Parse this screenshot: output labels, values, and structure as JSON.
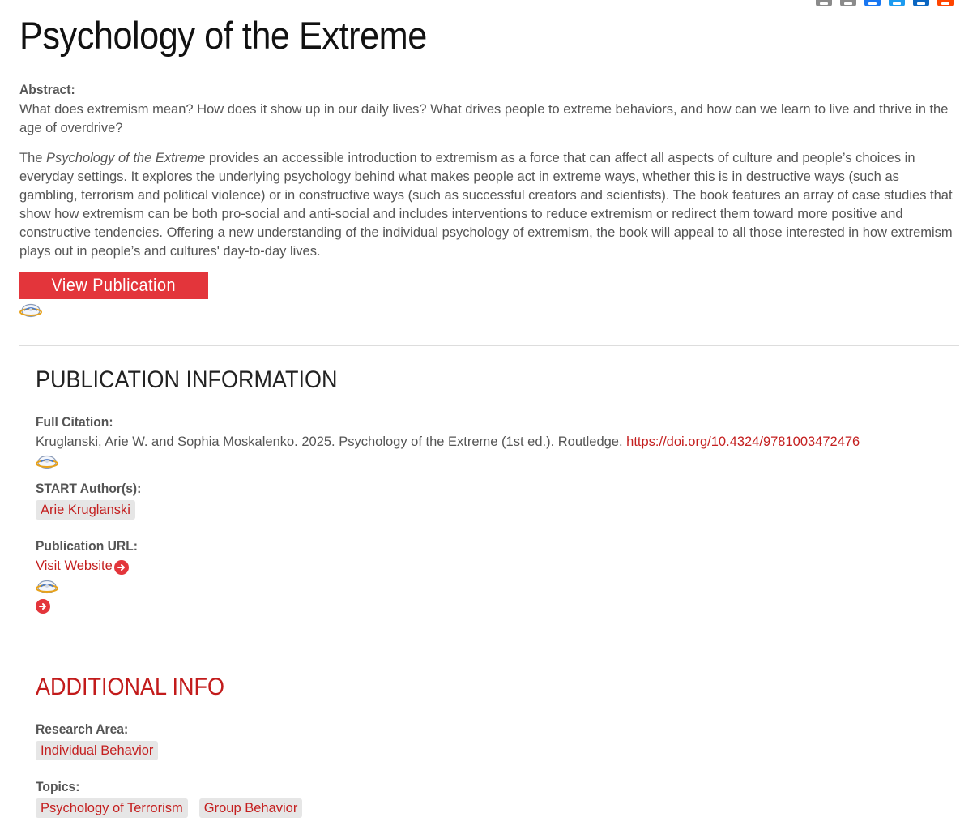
{
  "share": {
    "buttons": [
      {
        "name": "print",
        "color": "#8b8b8b"
      },
      {
        "name": "email",
        "color": "#8b8b8b"
      },
      {
        "name": "facebook",
        "color": "#1877f2"
      },
      {
        "name": "twitter",
        "color": "#1d9bf0"
      },
      {
        "name": "linkedin",
        "color": "#0a66c2"
      },
      {
        "name": "reddit",
        "color": "#ff4500"
      }
    ]
  },
  "page": {
    "title": "Psychology of the Extreme"
  },
  "abstract": {
    "label": "Abstract:",
    "para1": "What does extremism mean? How does it show up in our daily lives? What drives people to extreme behaviors, and how can we learn to live and thrive in the age of overdrive?",
    "para2_prefix": "The ",
    "para2_italic": "Psychology of the Extreme",
    "para2_rest": " provides an accessible introduction to extremism as a force that can affect all aspects of culture and people’s choices in everyday settings. It explores the underlying psychology behind what makes people act in extreme ways, whether this is in destructive ways (such as gambling, terrorism and political violence) or in constructive ways (such as successful creators and scientists). The book features an array of case studies that show how extremism can be both pro-social and anti-social and includes interventions to reduce extremism or redirect them toward more positive and constructive tendencies. Offering a new understanding of the individual psychology of extremism, the book will appeal to all those interested in how extremism plays out in people’s and cultures' day-to-day lives.",
    "button_label": "View Publication"
  },
  "pub_info": {
    "heading": "PUBLICATION INFORMATION",
    "citation_label": "Full Citation:",
    "citation_text": "Kruglanski, Arie W. and Sophia Moskalenko. 2025. Psychology of the Extreme (1st ed.). Routledge. ",
    "citation_link": "https://doi.org/10.4324/9781003472476",
    "authors_label": "START Author(s):",
    "authors": [
      "Arie Kruglanski"
    ],
    "url_label": "Publication URL:",
    "url_link": "Visit Website"
  },
  "additional": {
    "heading": "ADDITIONAL INFO",
    "research_label": "Research Area:",
    "research_areas": [
      "Individual Behavior"
    ],
    "topics_label": "Topics:",
    "topics": [
      "Psychology of Terrorism",
      "Group Behavior"
    ]
  },
  "colors": {
    "accent_red": "#e3353b",
    "link_red": "#c41f1f",
    "tag_bg": "#e6e6e6"
  }
}
